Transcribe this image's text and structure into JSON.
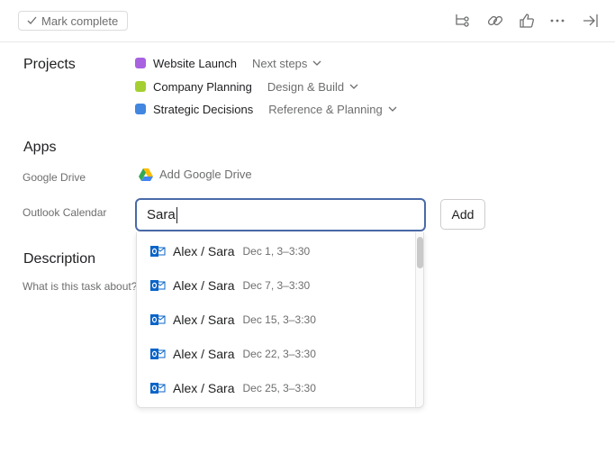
{
  "toolbar": {
    "mark_complete": "Mark complete",
    "icons": [
      "subtasks-icon",
      "link-icon",
      "thumbs-up-icon",
      "more-icon",
      "close-panel-icon"
    ]
  },
  "projects": {
    "label": "Projects",
    "items": [
      {
        "name": "Website Launch",
        "section": "Next steps",
        "color": "#a862e0"
      },
      {
        "name": "Company Planning",
        "section": "Design & Build",
        "color": "#a4cf30"
      },
      {
        "name": "Strategic Decisions",
        "section": "Reference & Planning",
        "color": "#4186e0"
      }
    ]
  },
  "apps": {
    "label": "Apps",
    "google_drive_label": "Google Drive",
    "add_google_drive": "Add Google Drive",
    "outlook_label": "Outlook Calendar",
    "input_value": "Sara",
    "add_button": "Add"
  },
  "description": {
    "label": "Description",
    "placeholder": "What is this task about?"
  },
  "results": [
    {
      "title": "Alex / Sara",
      "date": "Dec 1, 3–3:30"
    },
    {
      "title": "Alex / Sara",
      "date": "Dec 7, 3–3:30"
    },
    {
      "title": "Alex / Sara",
      "date": "Dec 15, 3–3:30"
    },
    {
      "title": "Alex / Sara",
      "date": "Dec 22, 3–3:30"
    },
    {
      "title": "Alex / Sara",
      "date": "Dec 25, 3–3:30"
    }
  ]
}
